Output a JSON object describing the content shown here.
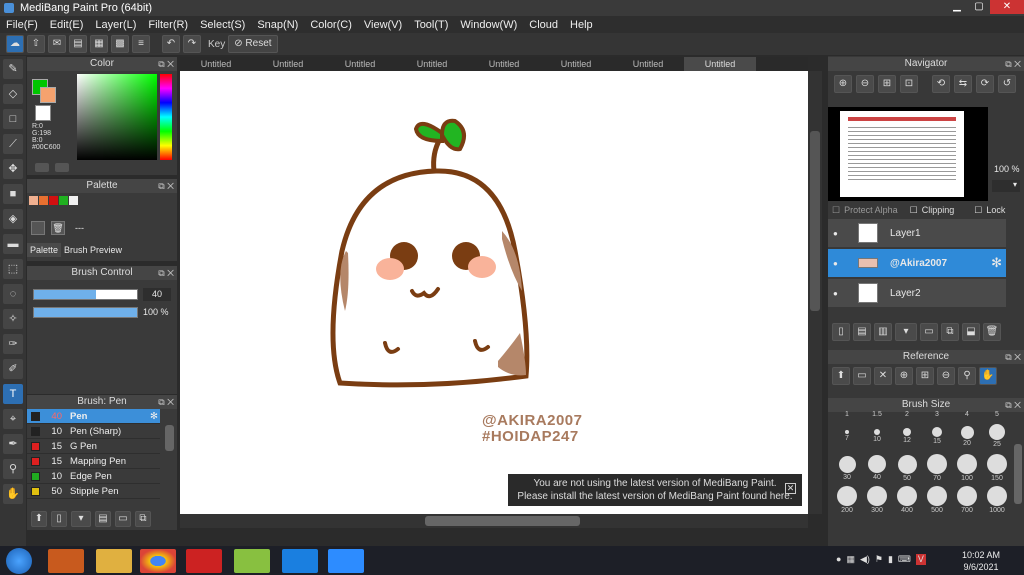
{
  "window": {
    "title": "MediBang Paint Pro (64bit)"
  },
  "menu": [
    "File(F)",
    "Edit(E)",
    "Layer(L)",
    "Filter(R)",
    "Select(S)",
    "Snap(N)",
    "Color(C)",
    "View(V)",
    "Tool(T)",
    "Window(W)",
    "Cloud",
    "Help"
  ],
  "toolbar": {
    "key_label": "Key",
    "reset_label": "Reset"
  },
  "tabs": [
    "Untitled",
    "Untitled",
    "Untitled",
    "Untitled",
    "Untitled",
    "Untitled",
    "Untitled",
    "Untitled"
  ],
  "color_panel": {
    "title": "Color",
    "r": "R:0",
    "g": "G:198",
    "b": "B:0",
    "hex": "#00C600",
    "primary": "#00c600",
    "secondary": "#f5a26e"
  },
  "palette_panel": {
    "title": "Palette",
    "tab1": "Palette",
    "tab2": "Brush Preview",
    "dash": "---",
    "swatches": [
      "#f0b090",
      "#e87030",
      "#d01010",
      "#20b020",
      "#f0f0f0"
    ]
  },
  "brush_control": {
    "title": "Brush Control",
    "size": "40",
    "opacity": "100 %",
    "size_fraction": 0.6,
    "opacity_fraction": 1.0
  },
  "brush_panel": {
    "title": "Brush: Pen",
    "items": [
      {
        "size": "40",
        "name": "Pen",
        "color": "#222222"
      },
      {
        "size": "10",
        "name": "Pen (Sharp)",
        "color": "#222222"
      },
      {
        "size": "15",
        "name": "G Pen",
        "color": "#dd2020"
      },
      {
        "size": "15",
        "name": "Mapping Pen",
        "color": "#dd2020"
      },
      {
        "size": "10",
        "name": "Edge Pen",
        "color": "#20aa20"
      },
      {
        "size": "50",
        "name": "Stipple Pen",
        "color": "#e0c010"
      }
    ]
  },
  "canvas": {
    "watermark_line1": "@AKIRA2007",
    "watermark_line2": "#HOIDAP247"
  },
  "notice": {
    "line1": "You are not using the latest version of MediBang Paint.",
    "line2": "Please install the latest version of MediBang Paint found here."
  },
  "navigator": {
    "title": "Navigator"
  },
  "layers": {
    "opacity": "100 %",
    "protect_alpha": "Protect Alpha",
    "clipping": "Clipping",
    "lock": "Lock",
    "items": [
      "Layer1",
      "@Akira2007",
      "Layer2"
    ]
  },
  "reference": {
    "title": "Reference"
  },
  "brush_size": {
    "title": "Brush Size",
    "top_labels": [
      "1",
      "1.5",
      "2",
      "3",
      "4",
      "5"
    ],
    "labels": [
      "7",
      "10",
      "12",
      "15",
      "20",
      "25",
      "30",
      "40",
      "50",
      "70",
      "100",
      "150",
      "200",
      "300",
      "400",
      "500",
      "700",
      "1000"
    ]
  },
  "taskbar": {
    "time": "10:02 AM",
    "date": "9/6/2021"
  }
}
